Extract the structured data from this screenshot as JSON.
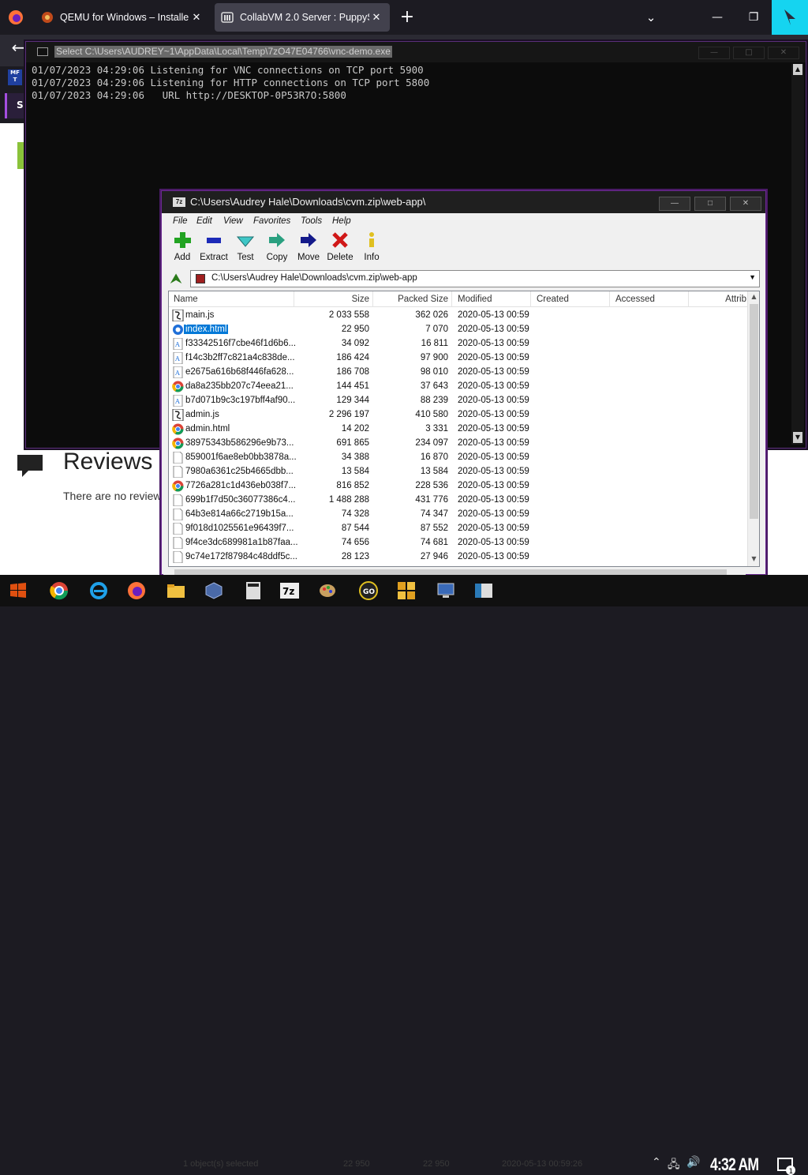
{
  "browser": {
    "tabs": [
      {
        "title": "QEMU for Windows – Installe"
      },
      {
        "title": "CollabVM 2.0 Server : PuppyS"
      }
    ],
    "new_tab": "+",
    "side_tab_label": "Se"
  },
  "webpage": {
    "reviews_title": "Reviews",
    "reviews_text": "There are no review"
  },
  "console": {
    "title": "Select C:\\Users\\AUDREY~1\\AppData\\Local\\Temp\\7zO47E04766\\vnc-demo.exe",
    "lines": [
      "01/07/2023 04:29:06 Listening for VNC connections on TCP port 5900",
      "01/07/2023 04:29:06 Listening for HTTP connections on TCP port 5800",
      "01/07/2023 04:29:06   URL http://DESKTOP-0P53R7O:5800"
    ]
  },
  "sevenzip": {
    "title": "C:\\Users\\Audrey Hale\\Downloads\\cvm.zip\\web-app\\",
    "menu": [
      "File",
      "Edit",
      "View",
      "Favorites",
      "Tools",
      "Help"
    ],
    "toolbar": [
      "Add",
      "Extract",
      "Test",
      "Copy",
      "Move",
      "Delete",
      "Info"
    ],
    "address": "C:\\Users\\Audrey Hale\\Downloads\\cvm.zip\\web-app",
    "columns": [
      "Name",
      "Size",
      "Packed Size",
      "Modified",
      "Created",
      "Accessed",
      "Attrib"
    ],
    "files": [
      {
        "name": "main.js",
        "size": "2 033 558",
        "packed": "362 026",
        "modified": "2020-05-13 00:59",
        "type": "js"
      },
      {
        "name": "index.html",
        "size": "22 950",
        "packed": "7 070",
        "modified": "2020-05-13 00:59",
        "type": "html-ie"
      },
      {
        "name": "f33342516f7cbe46f1d6b6...",
        "size": "34 092",
        "packed": "16 811",
        "modified": "2020-05-13 00:59",
        "type": "font"
      },
      {
        "name": "f14c3b2ff7c821a4c838de...",
        "size": "186 424",
        "packed": "97 900",
        "modified": "2020-05-13 00:59",
        "type": "font"
      },
      {
        "name": "e2675a616b68f446fa628...",
        "size": "186 708",
        "packed": "98 010",
        "modified": "2020-05-13 00:59",
        "type": "font"
      },
      {
        "name": "da8a235bb207c74eea21...",
        "size": "144 451",
        "packed": "37 643",
        "modified": "2020-05-13 00:59",
        "type": "chrome"
      },
      {
        "name": "b7d071b9c3c197bff4af90...",
        "size": "129 344",
        "packed": "88 239",
        "modified": "2020-05-13 00:59",
        "type": "font"
      },
      {
        "name": "admin.js",
        "size": "2 296 197",
        "packed": "410 580",
        "modified": "2020-05-13 00:59",
        "type": "js"
      },
      {
        "name": "admin.html",
        "size": "14 202",
        "packed": "3 331",
        "modified": "2020-05-13 00:59",
        "type": "chrome"
      },
      {
        "name": "38975343b586296e9b73...",
        "size": "691 865",
        "packed": "234 097",
        "modified": "2020-05-13 00:59",
        "type": "chrome"
      },
      {
        "name": "859001f6ae8eb0bb3878a...",
        "size": "34 388",
        "packed": "16 870",
        "modified": "2020-05-13 00:59",
        "type": "file"
      },
      {
        "name": "7980a6361c25b4665dbb...",
        "size": "13 584",
        "packed": "13 584",
        "modified": "2020-05-13 00:59",
        "type": "file"
      },
      {
        "name": "7726a281c1d436eb038f7...",
        "size": "816 852",
        "packed": "228 536",
        "modified": "2020-05-13 00:59",
        "type": "chrome"
      },
      {
        "name": "699b1f7d50c36077386c4...",
        "size": "1 488 288",
        "packed": "431 776",
        "modified": "2020-05-13 00:59",
        "type": "file"
      },
      {
        "name": "64b3e814a66c2719b15a...",
        "size": "74 328",
        "packed": "74 347",
        "modified": "2020-05-13 00:59",
        "type": "file"
      },
      {
        "name": "9f018d1025561e96439f7...",
        "size": "87 544",
        "packed": "87 552",
        "modified": "2020-05-13 00:59",
        "type": "file"
      },
      {
        "name": "9f4ce3dc689981a1b87faa...",
        "size": "74 656",
        "packed": "74 681",
        "modified": "2020-05-13 00:59",
        "type": "file"
      },
      {
        "name": "9c74e172f87984c48ddf5c...",
        "size": "28 123",
        "packed": "27 946",
        "modified": "2020-05-13 00:59",
        "type": "file"
      }
    ],
    "status_left": "1 object(s) selected",
    "status_size": "22 950",
    "status_packed": "22 950",
    "status_date": "2020-05-13 00:59:26"
  },
  "taskbar": {
    "clock": "4:32 AM",
    "notifications": "1"
  }
}
